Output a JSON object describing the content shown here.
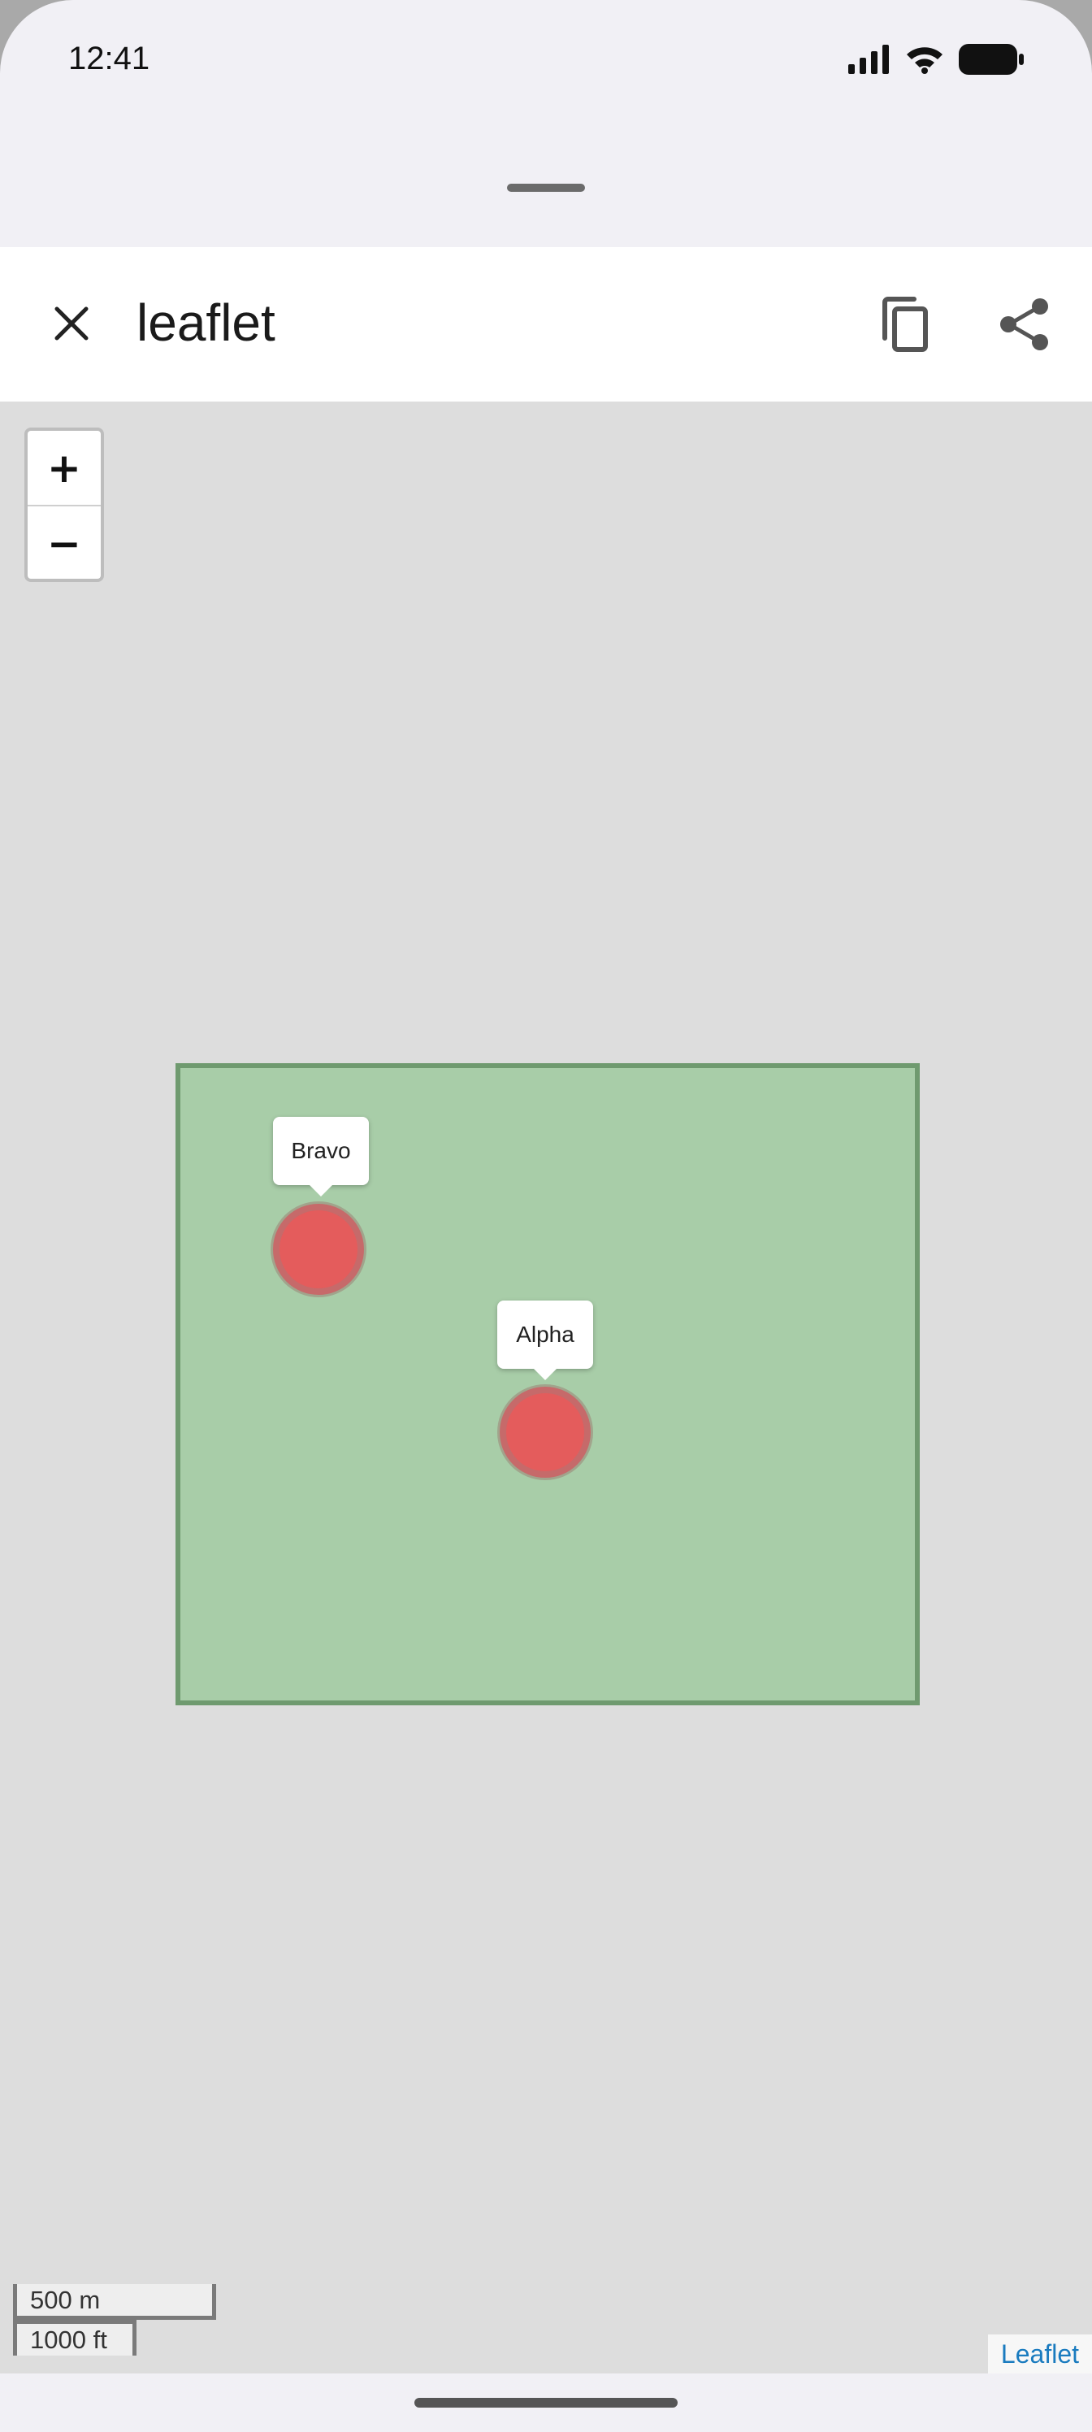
{
  "status_bar": {
    "time": "12:41"
  },
  "header": {
    "title": "leaflet"
  },
  "map": {
    "zoom_in_label": "+",
    "zoom_out_label": "−",
    "polygon_fill": "#a8cda8",
    "polygon_stroke": "#6f9a6f",
    "markers": [
      {
        "label": "Bravo",
        "color": "#e45c5c"
      },
      {
        "label": "Alpha",
        "color": "#e45c5c"
      }
    ],
    "scale": {
      "metric": "500 m",
      "imperial": "1000 ft"
    },
    "attribution": "Leaflet"
  }
}
